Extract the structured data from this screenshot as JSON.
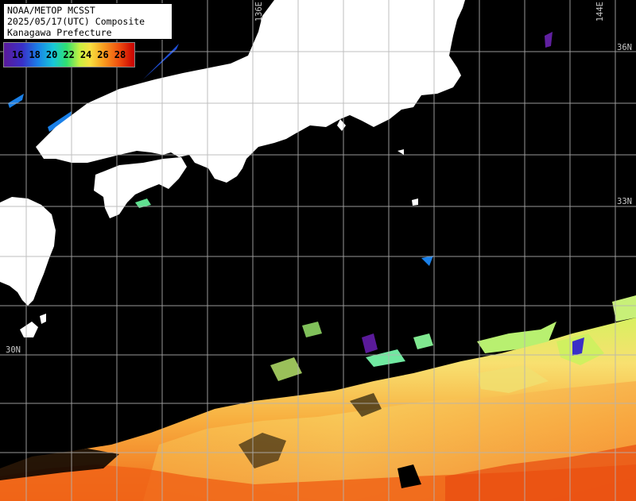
{
  "title": {
    "line1": "NOAA/METOP MCSST",
    "line2": "2025/05/17(UTC) Composite",
    "line3": "Kanagawa Prefecture"
  },
  "colorbar": {
    "labels": [
      "16",
      "18",
      "20",
      "22",
      "24",
      "26",
      "28"
    ],
    "colors": [
      "#5a1a9a",
      "#1a80e8",
      "#18c8d8",
      "#30e070",
      "#f8e040",
      "#f8a020",
      "#f05010",
      "#c80000"
    ]
  },
  "map_labels": {
    "lon_136": "136E",
    "lon_144": "144E",
    "lat_36": "36N",
    "lat_33": "33N",
    "lat_30": "30N"
  },
  "map_colors": {
    "ocean": "#000000",
    "land": "#ffffff",
    "grid": "#b4b4b4"
  }
}
